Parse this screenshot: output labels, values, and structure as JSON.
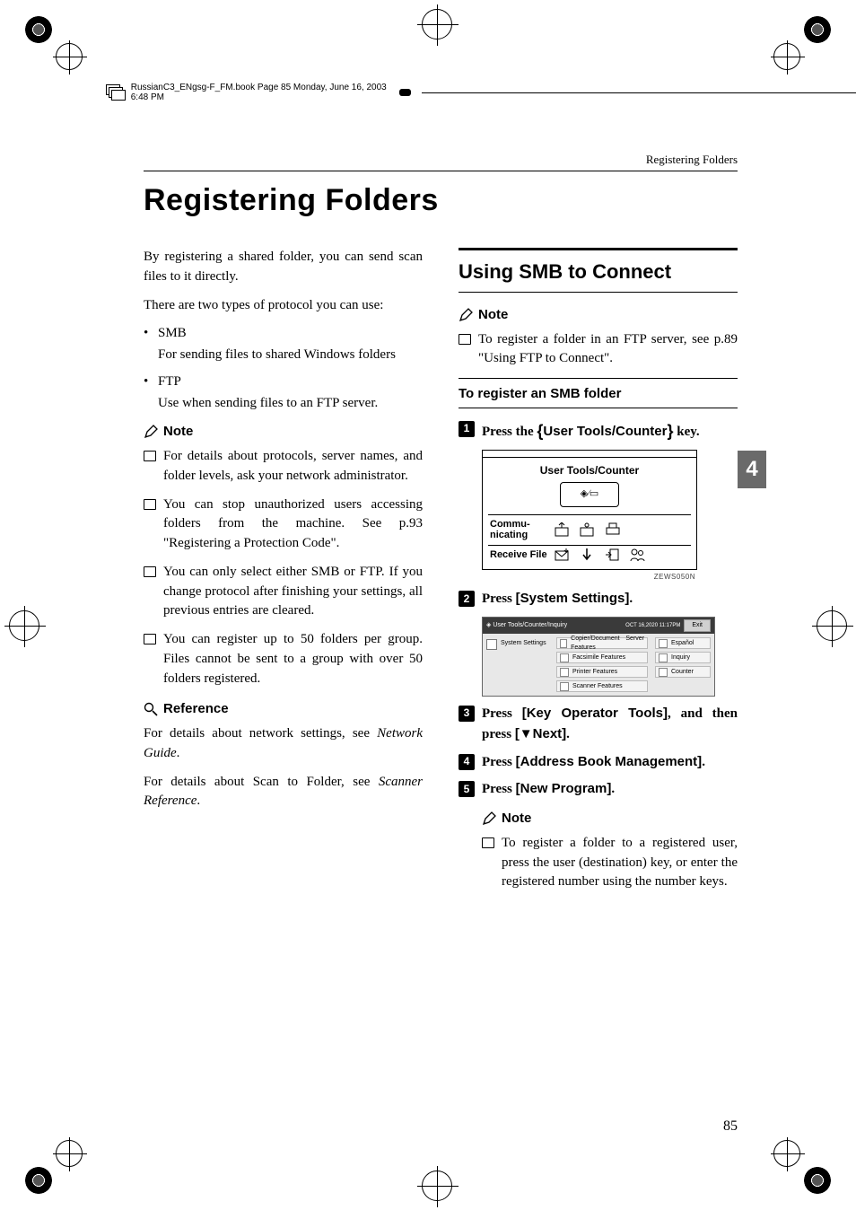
{
  "meta": {
    "book_header": "RussianC3_ENgsg-F_FM.book  Page 85  Monday, June 16, 2003  6:48 PM",
    "running_header": "Registering Folders",
    "page_number": "85",
    "side_tab": "4"
  },
  "title": "Registering Folders",
  "left": {
    "intro1": "By registering a shared folder, you can send scan files to it directly.",
    "intro2": "There are two types of protocol you can use:",
    "proto": [
      {
        "name": "SMB",
        "desc": "For sending files to shared Windows folders"
      },
      {
        "name": "FTP",
        "desc": "Use when sending files to an FTP server."
      }
    ],
    "note_heading": "Note",
    "notes": [
      "For details about protocols, server names, and folder levels, ask your network administrator.",
      "You can stop unauthorized users accessing folders from the machine. See p.93 \"Registering a Protection Code\".",
      "You can only select either SMB or FTP. If you change protocol after finishing your settings, all previous entries are cleared.",
      "You can register up to 50 folders per group. Files cannot be sent to a group with over 50 folders registered."
    ],
    "ref_heading": "Reference",
    "ref1a": "For details about network settings, see ",
    "ref1b": "Network Guide",
    "ref1c": ".",
    "ref2a": "For details about Scan to Folder, see ",
    "ref2b": "Scanner Reference",
    "ref2c": "."
  },
  "right": {
    "h2": "Using SMB to Connect",
    "note_heading": "Note",
    "note1": "To register a folder in an FTP server, see p.89 \"Using FTP to Connect\".",
    "h3": "To register an SMB folder",
    "steps": {
      "s1_a": "Press the ",
      "s1_key": "User Tools/Counter",
      "s1_b": " key.",
      "s2_a": "Press ",
      "s2_ui": "[System Settings]",
      "s2_b": ".",
      "s3_a": "Press ",
      "s3_ui1": "[Key Operator Tools]",
      "s3_mid": ", and then press ",
      "s3_ui2": "[▼Next]",
      "s3_b": ".",
      "s4_a": "Press ",
      "s4_ui": "[Address Book Management]",
      "s4_b": ".",
      "s5_a": "Press ",
      "s5_ui": "[New Program]",
      "s5_b": "."
    },
    "device": {
      "title": "User Tools/Counter",
      "btn_glyph": "◈∕▭",
      "row1": "Commu-nicating",
      "row2": "Receive File",
      "code": "ZEWS050N"
    },
    "sys": {
      "header": "User Tools/Counter/Inquiry",
      "date": "OCT   16,2020  11:17PM",
      "exit": "Exit",
      "left_label": "System Settings",
      "mid": [
        "Copier/Document Server Features",
        "Facsimile Features",
        "Printer Features",
        "Scanner Features"
      ],
      "right": [
        "Español",
        "Inquiry",
        "Counter"
      ]
    },
    "step5_note_heading": "Note",
    "step5_note": "To register a folder to a registered user, press the user (destination) key, or enter the registered number using the number keys."
  }
}
